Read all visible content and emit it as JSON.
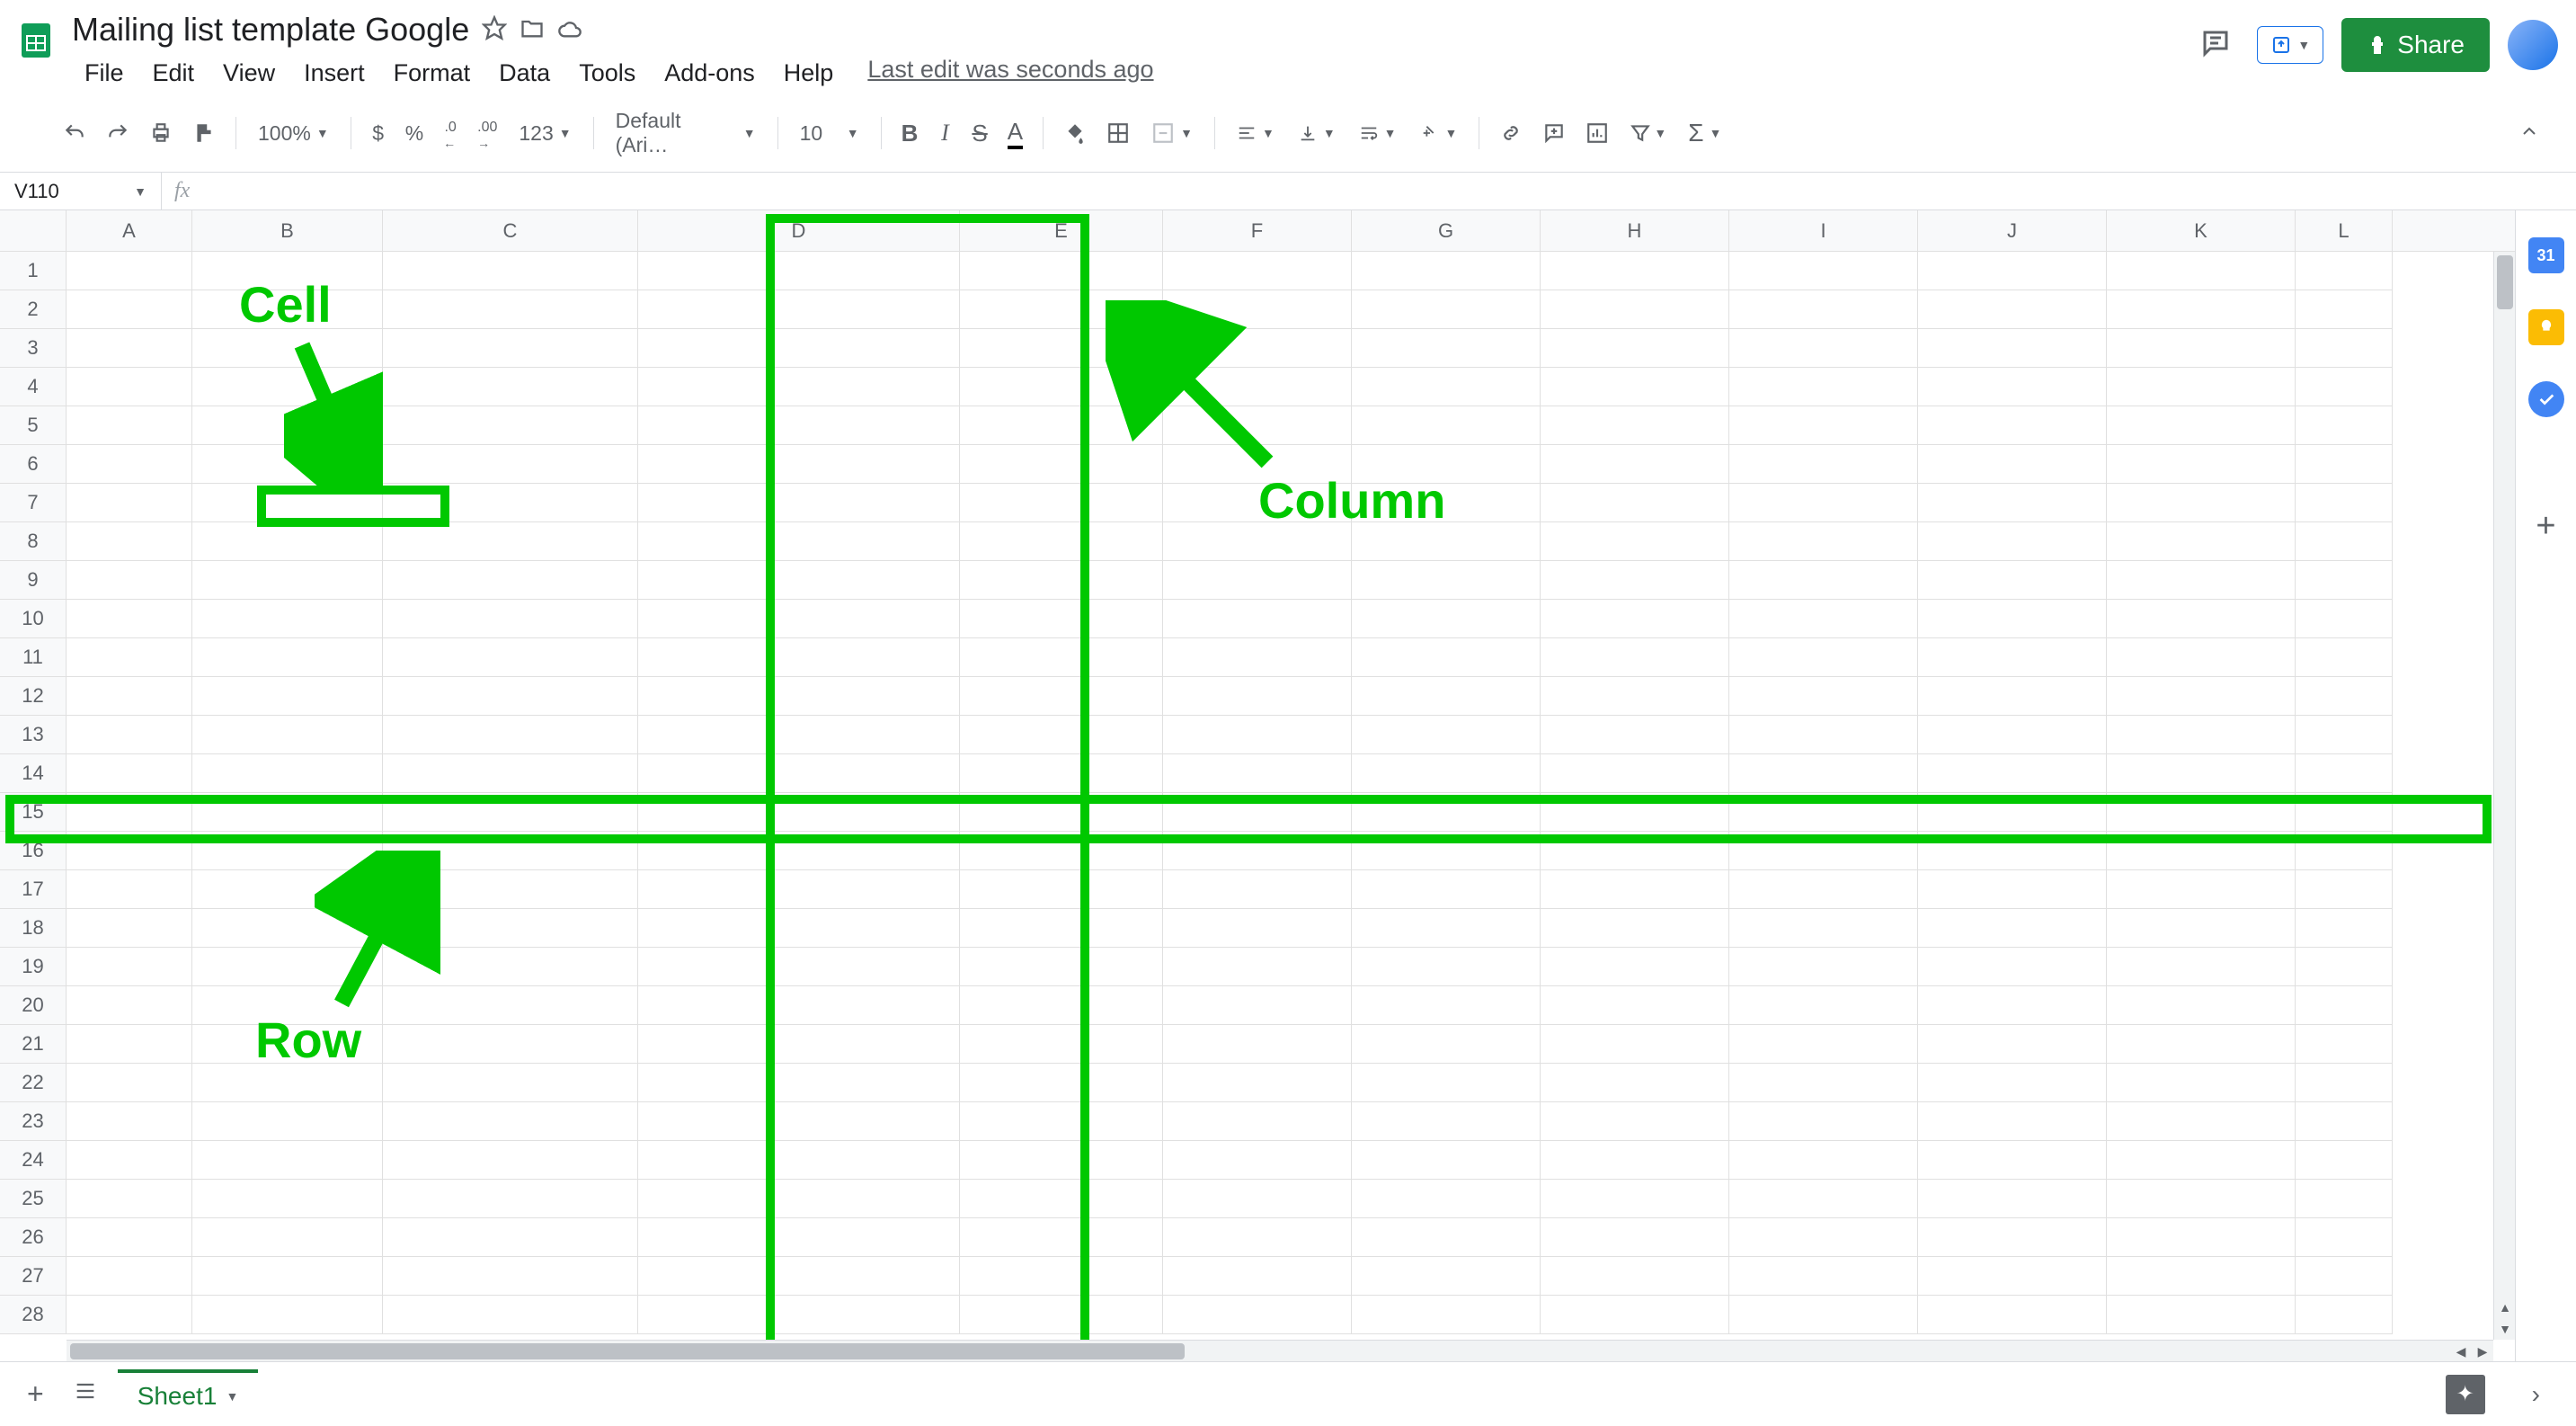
{
  "doc": {
    "title": "Mailing list template Google",
    "last_edit": "Last edit was seconds ago"
  },
  "menu": [
    "File",
    "Edit",
    "View",
    "Insert",
    "Format",
    "Data",
    "Tools",
    "Add-ons",
    "Help"
  ],
  "toolbar": {
    "zoom": "100%",
    "currency": "$",
    "percent": "%",
    "dec_dec": ".0",
    "inc_dec": ".00",
    "more_fmt": "123",
    "font": "Default (Ari…",
    "font_size": "10"
  },
  "share": {
    "label": "Share"
  },
  "name_box": "V110",
  "columns": [
    "A",
    "B",
    "C",
    "D",
    "E",
    "F",
    "G",
    "H",
    "I",
    "J",
    "K",
    "L"
  ],
  "rows": 28,
  "annotations": {
    "cell_label": "Cell",
    "column_label": "Column",
    "row_label": "Row",
    "highlight_color": "#00c800"
  },
  "tabs": {
    "sheet1": "Sheet1"
  }
}
